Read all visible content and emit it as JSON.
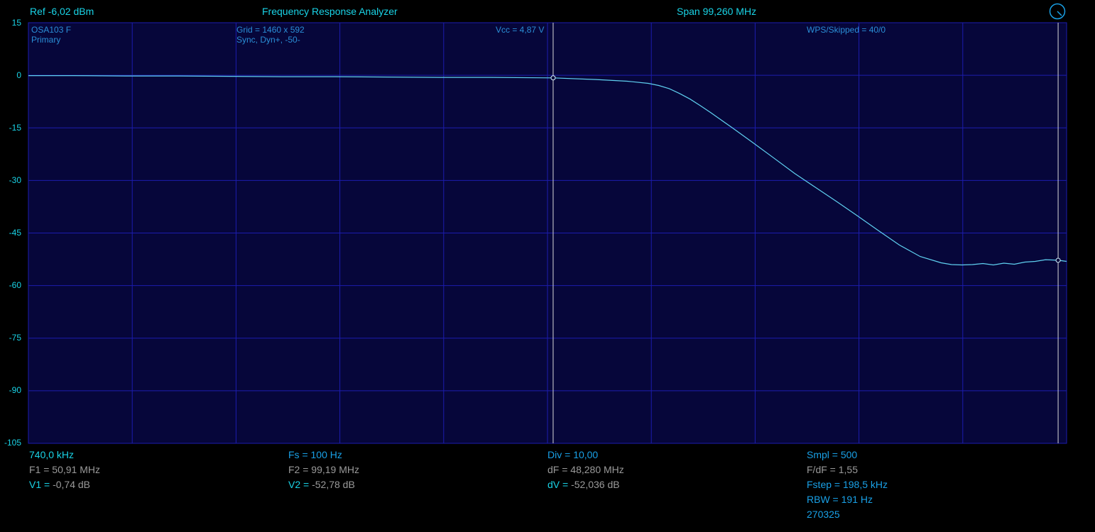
{
  "header": {
    "ref": "Ref  -6,02 dBm",
    "title": "Frequency Response Analyzer",
    "span": "Span 99,260 MHz"
  },
  "annotations": {
    "device": "OSA103 F",
    "mode": "Primary",
    "grid": "Grid = 1460 x 592",
    "sync": "Sync,  Dyn+,  -50-",
    "vcc": "Vcc = 4,87 V",
    "wps": "WPS/Skipped  = 40/0"
  },
  "y_axis_labels": [
    "15",
    "0",
    "-15",
    "-30",
    "-45",
    "-60",
    "-75",
    "-90",
    "-105"
  ],
  "footer": {
    "col1": {
      "start_freq": "740,0 kHz",
      "f1_key": "F1 =",
      "f1_val": "50,91 MHz",
      "v1_key": "V1 =",
      "v1_val": "-0,74 dB"
    },
    "col2": {
      "fs_key": "Fs =",
      "fs_val": "100 Hz",
      "f2_key": "F2 =",
      "f2_val": "99,19 MHz",
      "v2_key": "V2 =",
      "v2_val": "-52,78 dB"
    },
    "col3": {
      "div_key": "Div =",
      "div_val": "10,00",
      "df_key": "dF =",
      "df_val": "48,280 MHz",
      "dv_key": "dV =",
      "dv_val": "-52,036 dB"
    },
    "col4": {
      "smpl_key": "Smpl =",
      "smpl_val": "500",
      "fdf_key": "F/dF =",
      "fdf_val": "1,55",
      "fstep_key": "Fstep =",
      "fstep_val": "198,5 kHz",
      "rbw_key": "RBW =",
      "rbw_val": "191 Hz",
      "version": "270325"
    }
  },
  "colors": {
    "background": "#000000",
    "plot_background": "#06063a",
    "grid": "#1c1cae",
    "trace": "#5fd0f0",
    "label_cyan": "#19d3e6",
    "label_blue": "#2a8ed6",
    "value_gray": "#9a9a9a"
  },
  "chart_data": {
    "type": "line",
    "x_start_mhz": 0.74,
    "x_span_mhz": 99.26,
    "ylim": [
      -105,
      15
    ],
    "ylabel": "",
    "xlabel": "",
    "grid": true,
    "markers": [
      {
        "name": "F1",
        "freq_mhz": 50.91,
        "value_db": -0.74
      },
      {
        "name": "F2",
        "freq_mhz": 99.19,
        "value_db": -52.78
      }
    ],
    "series": [
      {
        "x": [
          0.74,
          5,
          10,
          15,
          20,
          25,
          30,
          35,
          40,
          45,
          50.91,
          55,
          58,
          60,
          61,
          62,
          63,
          64,
          65,
          66,
          67,
          68,
          70,
          72,
          74,
          76,
          78,
          80,
          82,
          84,
          86,
          88,
          89,
          90,
          91,
          92,
          93,
          94,
          95,
          96,
          97,
          98,
          99.19,
          100
        ],
        "y": [
          -0.1,
          -0.1,
          -0.2,
          -0.2,
          -0.3,
          -0.4,
          -0.4,
          -0.5,
          -0.6,
          -0.6,
          -0.74,
          -1.2,
          -1.7,
          -2.3,
          -2.9,
          -3.8,
          -5.2,
          -6.8,
          -8.7,
          -10.7,
          -12.8,
          -14.9,
          -19.2,
          -23.6,
          -28.0,
          -32.0,
          -36.0,
          -40.1,
          -44.3,
          -48.4,
          -51.7,
          -53.5,
          -54.0,
          -54.1,
          -54.0,
          -53.7,
          -54.1,
          -53.6,
          -53.9,
          -53.3,
          -53.1,
          -52.6,
          -52.78,
          -53.1
        ]
      }
    ]
  }
}
